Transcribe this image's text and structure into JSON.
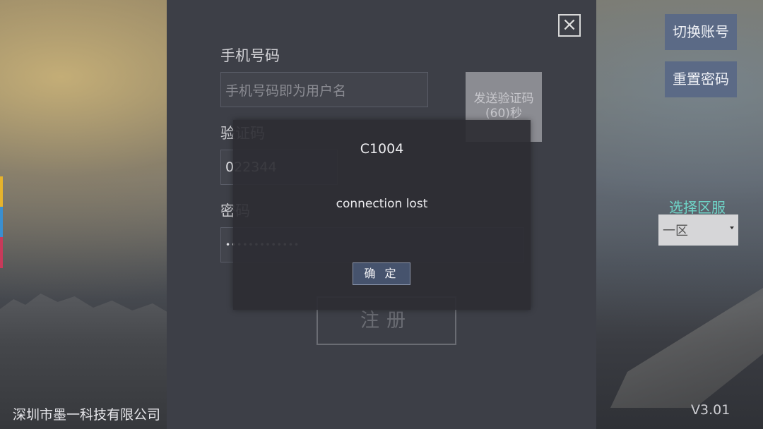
{
  "form": {
    "phone_label": "手机号码",
    "phone_placeholder": "手机号码即为用户名",
    "code_label": "验证码",
    "code_value": "022344",
    "send_code_label": "发送验证码",
    "send_code_countdown": "(60)秒",
    "password_label": "密码",
    "password_value": "•••••••••••••",
    "register_label": "注册"
  },
  "sidebar": {
    "switch_account_label": "切换账号",
    "reset_password_label": "重置密码",
    "region_label": "选择区服",
    "region_selected": "一区"
  },
  "footer": {
    "company": "深圳市墨一科技有限公司",
    "version": "V3.01"
  },
  "modal": {
    "title": "C1004",
    "message": "connection lost",
    "ok_label": "确 定"
  },
  "icons": {
    "close": "close-icon",
    "dropdown": "chevron-down-icon"
  },
  "colors": {
    "panel": "#3d3f47",
    "side_button": "#5b6a86",
    "region_label": "#6fd4c7",
    "modal_button": "#46536d"
  }
}
